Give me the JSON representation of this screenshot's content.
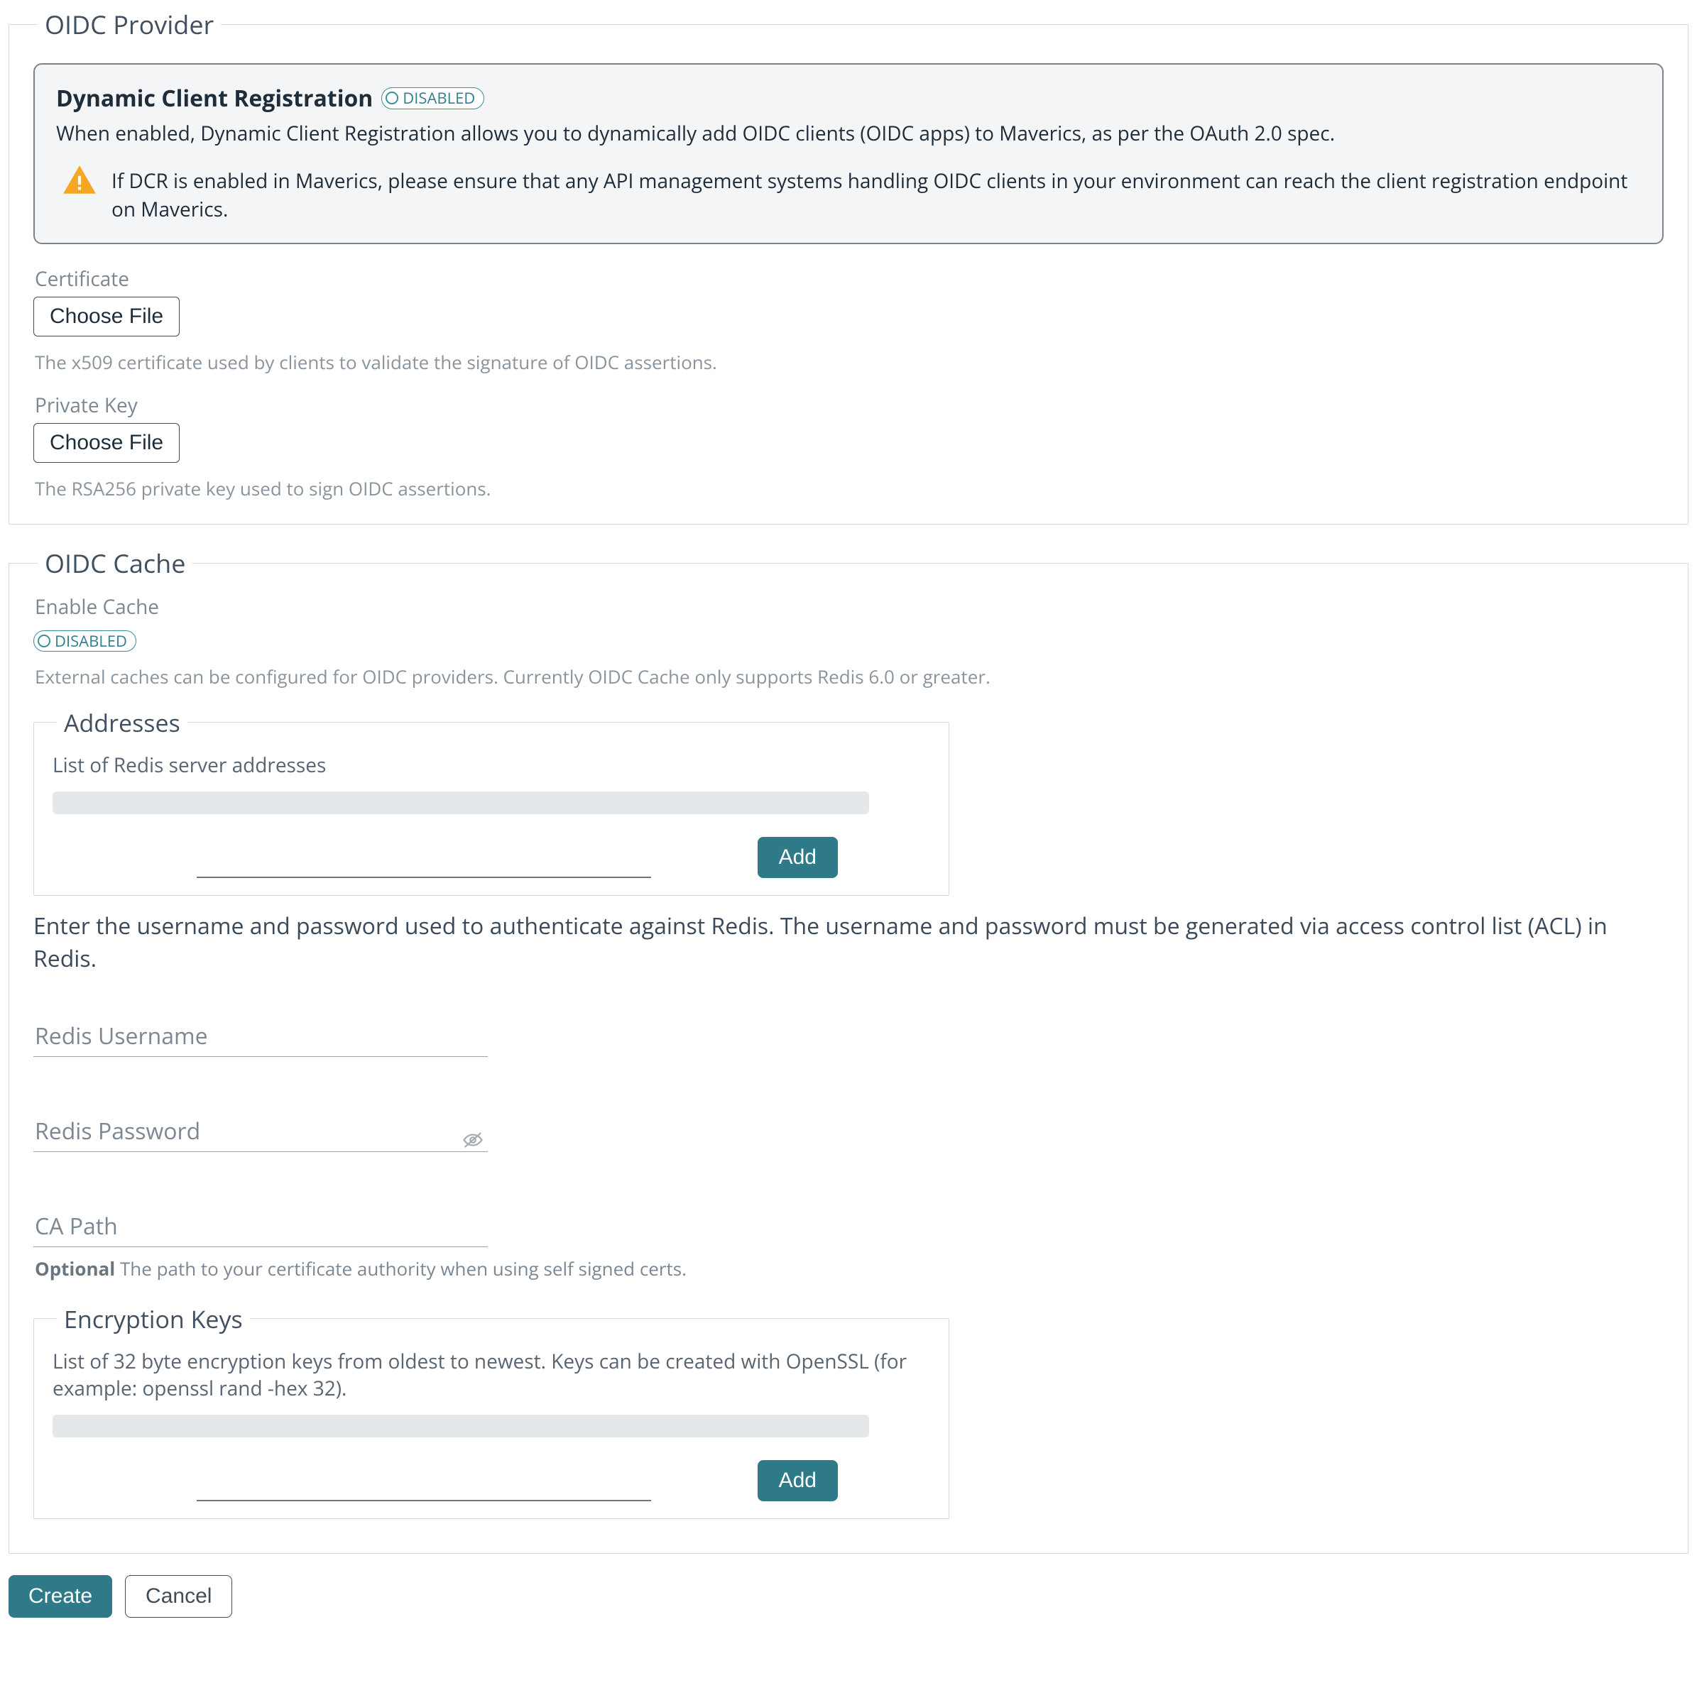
{
  "oidc_provider": {
    "legend": "OIDC Provider",
    "dcr": {
      "title": "Dynamic Client Registration",
      "badge": "DISABLED",
      "description": "When enabled, Dynamic Client Registration allows you to dynamically add OIDC clients (OIDC apps) to Maverics, as per the OAuth 2.0 spec.",
      "warning": "If DCR is enabled in Maverics, please ensure that any API management systems handling OIDC clients in your environment can reach the client registration endpoint on Maverics."
    },
    "certificate": {
      "label": "Certificate",
      "button": "Choose File",
      "help": "The x509 certificate used by clients to validate the signature of OIDC assertions."
    },
    "private_key": {
      "label": "Private Key",
      "button": "Choose File",
      "help": "The RSA256 private key used to sign OIDC assertions."
    }
  },
  "oidc_cache": {
    "legend": "OIDC Cache",
    "enable_label": "Enable Cache",
    "enable_badge": "DISABLED",
    "help": "External caches can be configured for OIDC providers. Currently OIDC Cache only supports Redis 6.0 or greater.",
    "addresses": {
      "legend": "Addresses",
      "desc": "List of Redis server addresses",
      "add": "Add"
    },
    "auth_explain": "Enter the username and password used to authenticate against Redis. The username and password must be generated via access control list (ACL) in Redis.",
    "redis_username_label": "Redis Username",
    "redis_password_label": "Redis Password",
    "ca_path_label": "CA Path",
    "ca_path_help_prefix": "Optional",
    "ca_path_help": "The path to your certificate authority when using self signed certs.",
    "encryption_keys": {
      "legend": "Encryption Keys",
      "desc": "List of 32 byte encryption keys from oldest to newest. Keys can be created with OpenSSL (for example: openssl rand -hex 32).",
      "add": "Add"
    }
  },
  "footer": {
    "create": "Create",
    "cancel": "Cancel"
  }
}
